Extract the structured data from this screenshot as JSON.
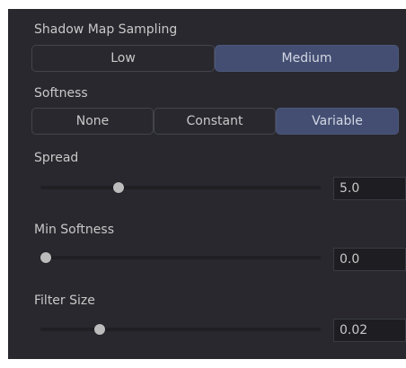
{
  "shadow_map_sampling": {
    "label": "Shadow Map Sampling",
    "options": [
      "Low",
      "Medium"
    ],
    "selected": "Medium"
  },
  "softness": {
    "label": "Softness",
    "options": [
      "None",
      "Constant",
      "Variable"
    ],
    "selected": "Variable"
  },
  "spread": {
    "label": "Spread",
    "value": "5.0",
    "slider_fraction": 0.27
  },
  "min_softness": {
    "label": "Min Softness",
    "value": "0.0",
    "slider_fraction": 0.0
  },
  "filter_size": {
    "label": "Filter Size",
    "value": "0.02",
    "slider_fraction": 0.2
  },
  "colors": {
    "panel_bg": "#28282e",
    "active_button": "#434e72",
    "text": "#c9c9c9",
    "slider_handle": "#bcbcbc"
  }
}
